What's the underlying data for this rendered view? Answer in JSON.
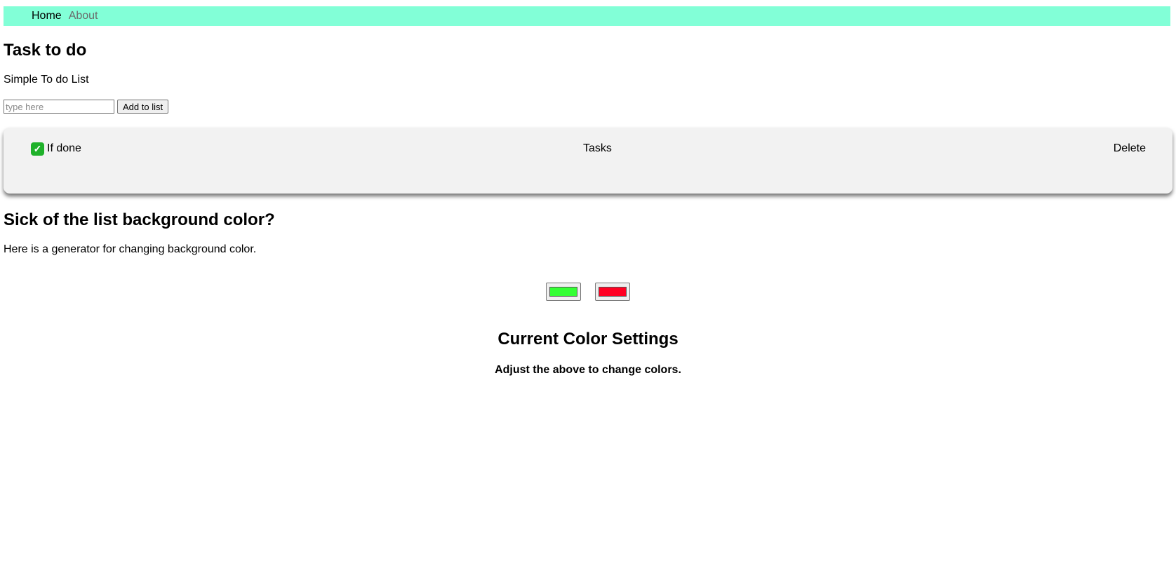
{
  "nav": {
    "home": "Home",
    "about": "About",
    "background": "#82ffd7"
  },
  "main": {
    "title": "Task to do",
    "subtitle": "Simple To do List",
    "input_placeholder": "type here",
    "add_button": "Add to list"
  },
  "task_table": {
    "done_icon": "check-mark-icon",
    "done_label": "If done",
    "tasks_label": "Tasks",
    "delete_label": "Delete",
    "background": "#f2f2f2"
  },
  "color_section": {
    "title": "Sick of the list background color?",
    "description": "Here is a generator for changing background color.",
    "color1": "#33ff33",
    "color2": "#ff0022"
  },
  "settings": {
    "title": "Current Color Settings",
    "hint": "Adjust the above to change colors."
  }
}
